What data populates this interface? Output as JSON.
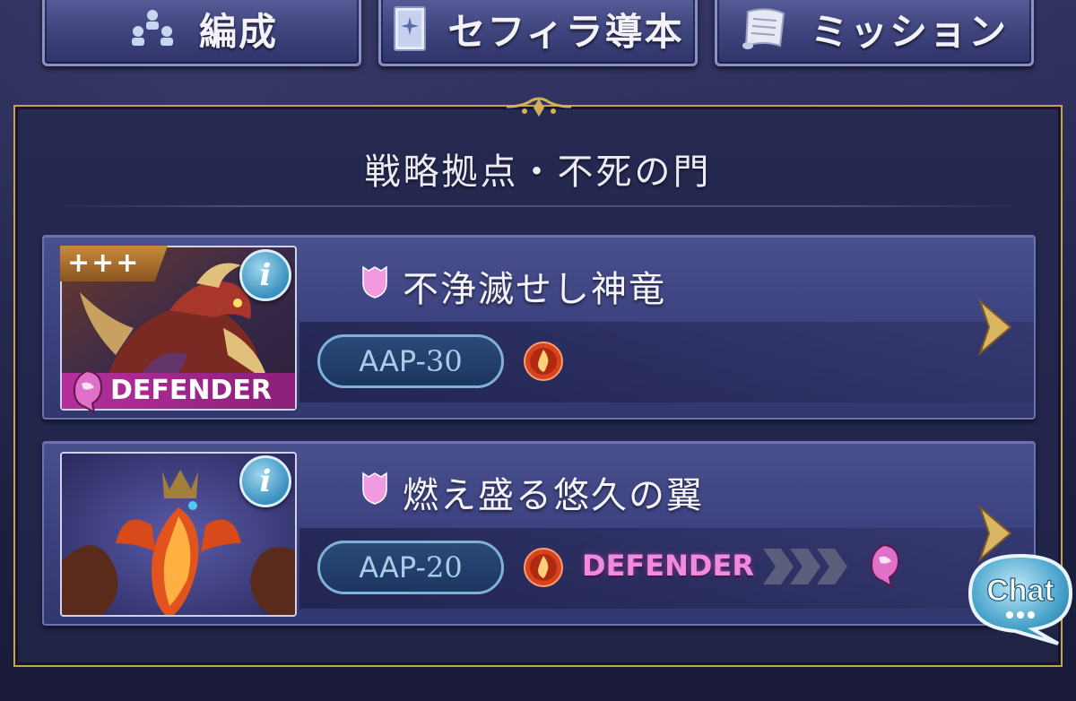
{
  "nav": {
    "formation_label": "編成",
    "guide_label": "セフィラ導本",
    "mission_label": "ミッション"
  },
  "panel": {
    "title": "戦略拠点・不死の門"
  },
  "quests": [
    {
      "title": "不浄滅せし神竜",
      "aap_prefix": "AAP-",
      "aap_value": "30",
      "plus_badge": "+++",
      "defender_label": "DEFENDER",
      "element": "fire"
    },
    {
      "title": "燃え盛る悠久の翼",
      "aap_prefix": "AAP-",
      "aap_value": "20",
      "defender_label": "DEFENDER",
      "element": "fire"
    }
  ],
  "chat": {
    "label": "Chat"
  },
  "colors": {
    "frame_gold": "#c9a24c",
    "panel_bg": "#262a52",
    "defender_magenta": "#b62f9d",
    "aap_blue": "#7fb0d8",
    "fire_red": "#d8431f"
  }
}
